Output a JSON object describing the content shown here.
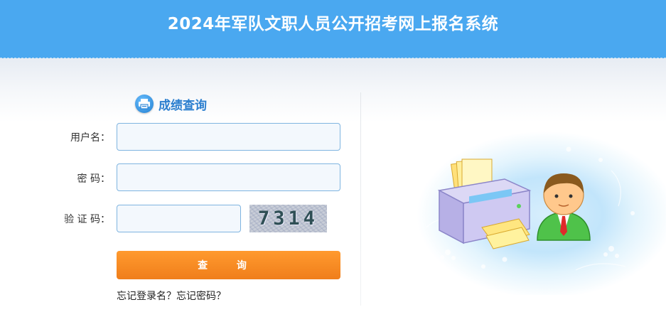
{
  "header": {
    "title": "2024年军队文职人员公开招考网上报名系统"
  },
  "section": {
    "title": "成绩查询",
    "icon": "printer-icon"
  },
  "form": {
    "username_label": "用户名：",
    "password_label": "密 码：",
    "captcha_label": "验 证 码：",
    "username_value": "",
    "password_value": "",
    "captcha_value": "",
    "captcha_image_text": "7314",
    "submit_label": "查 询"
  },
  "links": {
    "forgot_username": "忘记登录名？",
    "forgot_password": "忘记密码？"
  },
  "illustration": {
    "icon": "printer-and-user-illustration"
  },
  "colors": {
    "header_bg": "#4aa8f0",
    "accent": "#2c7fcf",
    "button": "#f5861f",
    "input_border": "#7fb4e0"
  }
}
